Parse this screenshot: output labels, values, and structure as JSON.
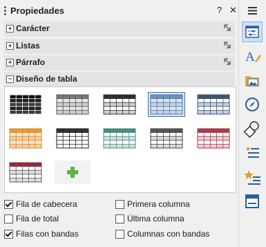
{
  "panel": {
    "title": "Propiedades",
    "help_label": "?",
    "close_label": "✕"
  },
  "sections": [
    {
      "label": "Carácter",
      "expanded": false
    },
    {
      "label": "Listas",
      "expanded": false
    },
    {
      "label": "Párrafo",
      "expanded": false
    },
    {
      "label": "Diseño de tabla",
      "expanded": true
    }
  ],
  "gallery": {
    "styles": [
      {
        "header": "#111111",
        "row": "#1f1f1f",
        "alt": "#3a3a3a",
        "line": "#ffffff",
        "selected": false
      },
      {
        "header": "#7a7a7a",
        "row": "#e8e8e8",
        "alt": "#cfcfcf",
        "line": "#555555",
        "selected": false
      },
      {
        "header": "#2e2e2e",
        "row": "#ffffff",
        "alt": "#d0d0d0",
        "line": "#333333",
        "selected": false
      },
      {
        "header": "#6f93b8",
        "row": "#dde6f0",
        "alt": "#c4d3e3",
        "line": "#4d79a8",
        "selected": true
      },
      {
        "header": "#3b5574",
        "row": "#ffffff",
        "alt": "#c3cfdc",
        "line": "#3b5574",
        "selected": false
      },
      {
        "header": "#e69a3a",
        "row": "#fbe6cc",
        "alt": "#f4cf9f",
        "line": "#d88a2c",
        "selected": false
      },
      {
        "header": "#333333",
        "row": "#ffffff",
        "alt": "#ffffff",
        "line": "#222222",
        "selected": false
      },
      {
        "header": "#4a8c84",
        "row": "#ffffff",
        "alt": "#cde3df",
        "line": "#4a8c84",
        "selected": false
      },
      {
        "header": "#555555",
        "row": "#ffffff",
        "alt": "#dddddd",
        "line": "#444444",
        "selected": false
      },
      {
        "header": "#a83a4e",
        "row": "#ffffff",
        "alt": "#f0cdd4",
        "line": "#a83a4e",
        "selected": false
      },
      {
        "header": "#a8203a",
        "row": "#ffffff",
        "alt": "#e0e0e0",
        "line": "#555555",
        "selected": false
      }
    ],
    "add_icon_color": "#5cb544"
  },
  "options": {
    "header_row": {
      "label": "Fila de cabecera",
      "checked": true
    },
    "first_column": {
      "label": "Primera columna",
      "checked": false
    },
    "total_row": {
      "label": "Fila de total",
      "checked": false
    },
    "last_column": {
      "label": "Última columna",
      "checked": false
    },
    "banded_rows": {
      "label": "Filas con bandas",
      "checked": true
    },
    "banded_columns": {
      "label": "Columnas con bandas",
      "checked": false
    }
  },
  "tabbar": {
    "menu_icon": "hamburger-menu-icon",
    "tabs": [
      {
        "icon": "properties-icon",
        "active": true
      },
      {
        "icon": "styles-icon",
        "active": false
      },
      {
        "icon": "gallery-icon",
        "active": false
      },
      {
        "icon": "navigator-icon",
        "active": false
      },
      {
        "icon": "shapes-icon",
        "active": false
      },
      {
        "icon": "page-icon",
        "active": false
      },
      {
        "icon": "style-inspector-icon",
        "active": false
      },
      {
        "icon": "manage-changes-icon",
        "active": false
      }
    ]
  }
}
